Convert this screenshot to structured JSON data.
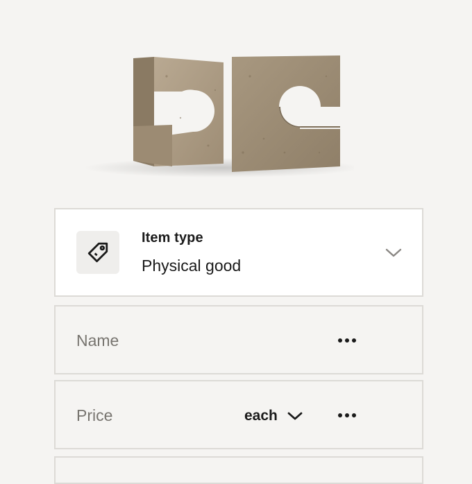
{
  "product_image": {
    "alt": "travertine-bookends"
  },
  "item_type": {
    "heading": "Item type",
    "value": "Physical good",
    "icon": "tag-icon"
  },
  "name_field": {
    "placeholder": "Name",
    "menu_icon": "more-dots-icon"
  },
  "price_field": {
    "placeholder": "Price",
    "unit": "each",
    "menu_icon": "more-dots-icon"
  },
  "colors": {
    "background": "#f5f4f2",
    "card_border": "#dcdad6",
    "placeholder_text": "#77746f",
    "primary_text": "#1a1a1a"
  }
}
